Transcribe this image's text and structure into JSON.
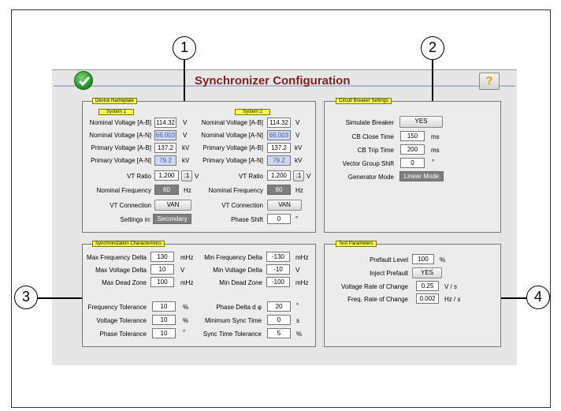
{
  "app": {
    "title": "Synchronizer Configuration",
    "help_label": "?"
  },
  "callouts": [
    "1",
    "2",
    "3",
    "4"
  ],
  "device_nameplate": {
    "tag": "Device Nameplate",
    "system1": {
      "tag": "System 1",
      "nominal_ab_label": "Nominal Voltage [A-B]",
      "nominal_ab": "114.32",
      "nominal_ab_unit": "V",
      "nominal_an_label": "Nominal Voltage [A-N]",
      "nominal_an": "66.003",
      "nominal_an_unit": "V",
      "primary_ab_label": "Primary Voltage [A-B]",
      "primary_ab": "137.2",
      "primary_ab_unit": "kV",
      "primary_an_label": "Primary Voltage [A-N]",
      "primary_an": "79.2",
      "primary_an_unit": "kV",
      "vt_ratio_label": "VT Ratio",
      "vt_ratio": "1,200",
      "vt_ratio_btn": ":1",
      "vt_ratio_unit": "V",
      "freq_label": "Nominal Frequency",
      "freq": "60",
      "freq_unit": "Hz",
      "vt_conn_label": "VT Connection",
      "vt_conn": "VAN",
      "settings_label": "Settings in:",
      "settings": "Secondary"
    },
    "system2": {
      "tag": "System 2",
      "nominal_ab_label": "Nominal Voltage [A-B]",
      "nominal_ab": "114.32",
      "nominal_ab_unit": "V",
      "nominal_an_label": "Nominal Voltage [A-N]",
      "nominal_an": "66.003",
      "nominal_an_unit": "V",
      "primary_ab_label": "Primary Voltage [A-B]",
      "primary_ab": "137.2",
      "primary_ab_unit": "kV",
      "primary_an_label": "Primary Voltage [A-N]",
      "primary_an": "79.2",
      "primary_an_unit": "kV",
      "vt_ratio_label": "VT Ratio",
      "vt_ratio": "1,200",
      "vt_ratio_btn": ":1",
      "vt_ratio_unit": "V",
      "freq_label": "Nominal Frequency",
      "freq": "60",
      "freq_unit": "Hz",
      "vt_conn_label": "VT Connection",
      "vt_conn": "VAN",
      "phase_label": "Phase Shift",
      "phase": "0",
      "phase_unit": "°"
    }
  },
  "circuit_breaker": {
    "tag": "Circuit Breaker Settings",
    "simulate_label": "Simulate Breaker",
    "simulate": "YES",
    "close_label": "CB Close Time",
    "close": "150",
    "close_unit": "ms",
    "trip_label": "CB Trip Time",
    "trip": "200",
    "trip_unit": "ms",
    "vg_label": "Vector Group Shift",
    "vg": "0",
    "vg_unit": "°",
    "gen_label": "Generator Mode",
    "gen": "Linear Mode"
  },
  "sync_char": {
    "tag": "Synchronization Characteristics",
    "max_freq_label": "Max Frequency Delta",
    "max_freq": "130",
    "max_freq_unit": "mHz",
    "max_volt_label": "Max Voltage Delta",
    "max_volt": "10",
    "max_volt_unit": "V",
    "max_dead_label": "Max Dead Zone",
    "max_dead": "100",
    "max_dead_unit": "mHz",
    "min_freq_label": "Min Frequency Delta",
    "min_freq": "-130",
    "min_freq_unit": "mHz",
    "min_volt_label": "Min Voltage Delta",
    "min_volt": "-10",
    "min_volt_unit": "V",
    "min_dead_label": "Min Dead Zone",
    "min_dead": "-100",
    "min_dead_unit": "mHz",
    "freq_tol_label": "Frequency Tolerance",
    "freq_tol": "10",
    "freq_tol_unit": "%",
    "volt_tol_label": "Voltage Tolerance",
    "volt_tol": "10",
    "volt_tol_unit": "%",
    "phase_tol_label": "Phase Tolerance",
    "phase_tol": "10",
    "phase_tol_unit": "°",
    "phase_delta_label": "Phase Delta d φ",
    "phase_delta": "20",
    "phase_delta_unit": "°",
    "min_sync_label": "Minimum Sync Time",
    "min_sync": "0",
    "min_sync_unit": "s",
    "sync_tol_label": "Sync Time Tolerance",
    "sync_tol": "5",
    "sync_tol_unit": "%"
  },
  "test_params": {
    "tag": "Test Parameters",
    "prefault_label": "Prefault Level",
    "prefault": "100",
    "prefault_unit": "%",
    "inject_label": "Inject Prefault",
    "inject": "YES",
    "vroc_label": "Voltage Rate of Change",
    "vroc": "0.25",
    "vroc_unit": "V / s",
    "froc_label": "Freq. Rate of Change",
    "froc": "0.002",
    "froc_unit": "Hz / s"
  }
}
